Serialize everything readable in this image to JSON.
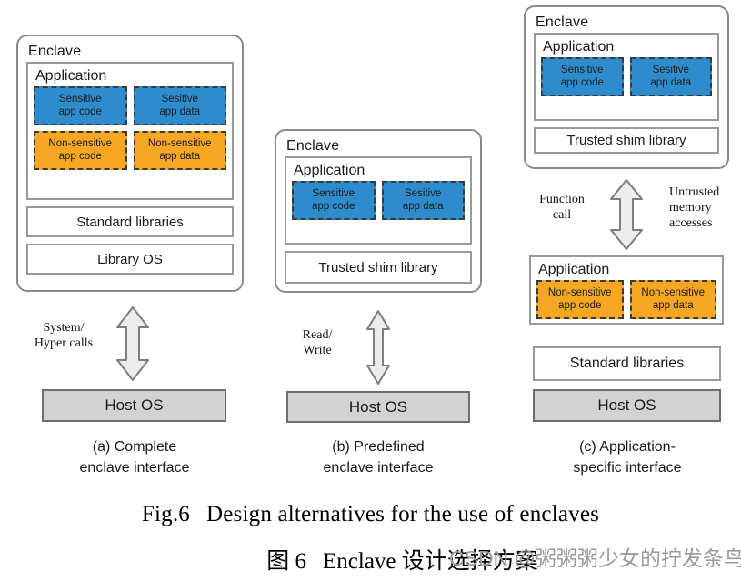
{
  "figure": {
    "caption_en_number": "Fig.6",
    "caption_en_text": "Design alternatives for the use of enclaves",
    "caption_zh_number": "图 6",
    "caption_zh_text": "Enclave 设计选择方案",
    "watermark": "CSDN @粥粥粥少女的拧发条鸟"
  },
  "colors": {
    "sensitive": "#2e8ccd",
    "non_sensitive": "#f5a723",
    "host_os": "#d2d2d2",
    "box_border": "#9a9a9a",
    "arrow_fill": "#ececec"
  },
  "panels": [
    {
      "id": "a",
      "subcaption_line1": "(a) Complete",
      "subcaption_line2": "enclave interface",
      "enclave_title": "Enclave",
      "application_title": "Application",
      "cells": [
        {
          "label_line1": "Sensitive",
          "label_line2": "app code",
          "kind": "blue"
        },
        {
          "label_line1": "Sesitive",
          "label_line2": "app data",
          "kind": "blue"
        },
        {
          "label_line1": "Non-sensitive",
          "label_line2": "app code",
          "kind": "orange"
        },
        {
          "label_line1": "Non-sensitive",
          "label_line2": "app data",
          "kind": "orange"
        }
      ],
      "bars": [
        "Standard libraries",
        "Library OS"
      ],
      "arrow_label_line1": "System/",
      "arrow_label_line2": "Hyper calls",
      "host_os": "Host OS"
    },
    {
      "id": "b",
      "subcaption_line1": "(b) Predefined",
      "subcaption_line2": "enclave interface",
      "enclave_title": "Enclave",
      "application_title": "Application",
      "cells": [
        {
          "label_line1": "Sensitive",
          "label_line2": "app code",
          "kind": "blue"
        },
        {
          "label_line1": "Sesitive",
          "label_line2": "app data",
          "kind": "blue"
        }
      ],
      "bars": [
        "Trusted shim library"
      ],
      "arrow_label_line1": "Read/",
      "arrow_label_line2": "Write",
      "host_os": "Host OS"
    },
    {
      "id": "c",
      "subcaption_line1": "(c) Application-",
      "subcaption_line2": "specific interface",
      "enclave_title": "Enclave",
      "application_title": "Application",
      "cells": [
        {
          "label_line1": "Sensitive",
          "label_line2": "app code",
          "kind": "blue"
        },
        {
          "label_line1": "Sesitive",
          "label_line2": "app data",
          "kind": "blue"
        }
      ],
      "bars": [
        "Trusted shim library"
      ],
      "arrow_label_left_line1": "Function",
      "arrow_label_left_line2": "call",
      "arrow_label_right_line1": "Untrusted",
      "arrow_label_right_line2": "memory",
      "arrow_label_right_line3": "accesses",
      "outer_application_title": "Application",
      "outer_cells": [
        {
          "label_line1": "Non-sensitive",
          "label_line2": "app code",
          "kind": "orange"
        },
        {
          "label_line1": "Non-sensitive",
          "label_line2": "app data",
          "kind": "orange"
        }
      ],
      "standard_libraries": "Standard libraries",
      "host_os": "Host OS"
    }
  ]
}
